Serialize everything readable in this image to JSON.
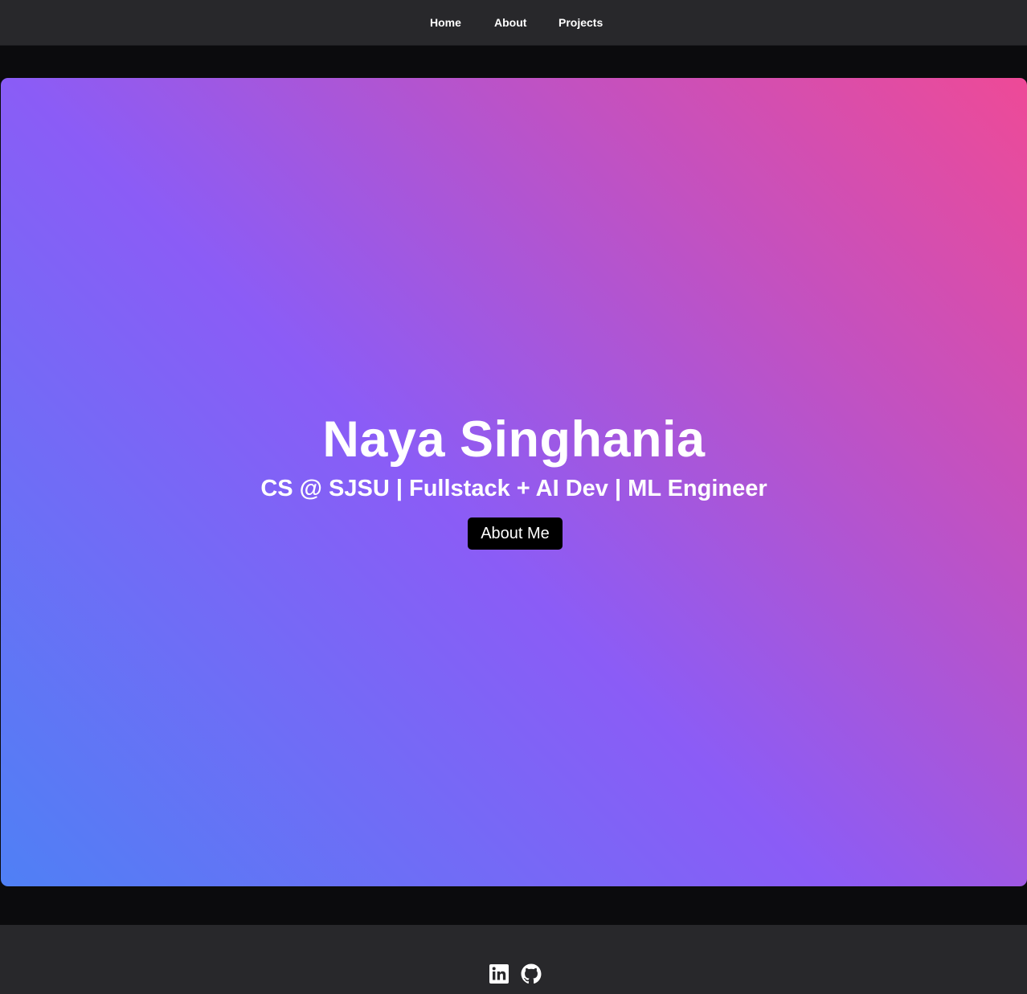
{
  "nav": {
    "items": [
      {
        "label": "Home"
      },
      {
        "label": "About"
      },
      {
        "label": "Projects"
      }
    ]
  },
  "hero": {
    "name": "Naya Singhania",
    "tagline": "CS @ SJSU | Fullstack + AI Dev | ML Engineer",
    "button_label": "About Me",
    "gradient_colors": [
      "#4f80f5",
      "#8b5cf6",
      "#c351c0",
      "#ee4a97"
    ]
  },
  "footer": {
    "social_icons": [
      "linkedin-icon",
      "github-icon"
    ]
  },
  "colors": {
    "page_background": "#0b0b0d",
    "bar_background": "#28282b",
    "button_background": "#000000",
    "text": "#ffffff"
  }
}
